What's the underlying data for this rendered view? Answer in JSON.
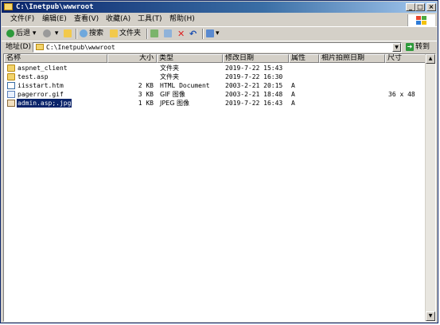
{
  "window": {
    "title": "C:\\Inetpub\\wwwroot",
    "minimize": "_",
    "maximize": "□",
    "close": "×"
  },
  "menu": [
    "文件(F)",
    "编辑(E)",
    "查看(V)",
    "收藏(A)",
    "工具(T)",
    "帮助(H)"
  ],
  "toolbar": {
    "back": "后退",
    "search": "搜索",
    "folders": "文件夹"
  },
  "address": {
    "label": "地址(D)",
    "value": "C:\\Inetpub\\wwwroot",
    "go": "转到"
  },
  "columns": {
    "name": "名称",
    "size": "大小",
    "type": "类型",
    "modified": "修改日期",
    "attr": "属性",
    "photo_date": "相片拍照日期",
    "dims": "尺寸"
  },
  "files": [
    {
      "name": "aspnet_client",
      "size": "",
      "type": "文件夹",
      "modified": "2019-7-22 15:43",
      "attr": "",
      "dims": "",
      "icon": "folder-icon"
    },
    {
      "name": "test.asp",
      "size": "",
      "type": "文件夹",
      "modified": "2019-7-22 16:30",
      "attr": "",
      "dims": "",
      "icon": "folder-icon"
    },
    {
      "name": "iisstart.htm",
      "size": "2 KB",
      "type": "HTML Document",
      "modified": "2003-2-21 20:15",
      "attr": "A",
      "dims": "",
      "icon": "html-file-icon"
    },
    {
      "name": "pagerror.gif",
      "size": "3 KB",
      "type": "GIF 图像",
      "modified": "2003-2-21 18:48",
      "attr": "A",
      "dims": "36 x 48",
      "icon": "gif-file-icon"
    },
    {
      "name": "admin.asp;.jpg",
      "size": "1 KB",
      "type": "JPEG 图像",
      "modified": "2019-7-22 16:43",
      "attr": "A",
      "dims": "",
      "icon": "jpeg-file-icon",
      "selected": true
    }
  ],
  "colors": {
    "titlebar": "#0a246a",
    "selection": "#0a246a",
    "chrome": "#d4d0c8"
  }
}
